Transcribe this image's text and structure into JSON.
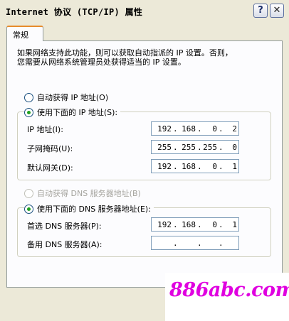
{
  "window": {
    "title": "Internet 协议 (TCP/IP) 属性",
    "help_glyph": "?",
    "close_glyph": "✕"
  },
  "tabs": [
    {
      "label": "常规"
    }
  ],
  "intro": {
    "line1": "如果网络支持此功能，则可以获取自动指派的 IP 设置。否则，",
    "line2": "您需要从网络系统管理员处获得适当的 IP 设置。"
  },
  "ip_section": {
    "auto_label": "自动获得 IP 地址(O)",
    "manual_label": "使用下面的 IP 地址(S):",
    "selected": "manual",
    "fields": [
      {
        "label": "IP 地址(I):",
        "octets": [
          "192",
          "168",
          "0",
          "2"
        ]
      },
      {
        "label": "子网掩码(U):",
        "octets": [
          "255",
          "255",
          "255",
          "0"
        ]
      },
      {
        "label": "默认网关(D):",
        "octets": [
          "192",
          "168",
          "0",
          "1"
        ]
      }
    ]
  },
  "dns_section": {
    "auto_label": "自动获得 DNS 服务器地址(B)",
    "auto_disabled": true,
    "manual_label": "使用下面的 DNS 服务器地址(E):",
    "selected": "manual",
    "fields": [
      {
        "label": "首选 DNS 服务器(P):",
        "octets": [
          "192",
          "168",
          "0",
          "1"
        ]
      },
      {
        "label": "备用 DNS 服务器(A):",
        "octets": [
          "",
          "",
          "",
          ""
        ]
      }
    ]
  },
  "watermark": {
    "text": "886abc.com",
    "color": "#E000E0"
  },
  "colors": {
    "dialog_bg": "#ECE9D8",
    "panel_bg": "#FCFCFE",
    "tab_accent": "#E68B2C",
    "radio_dot": "#21A121"
  }
}
